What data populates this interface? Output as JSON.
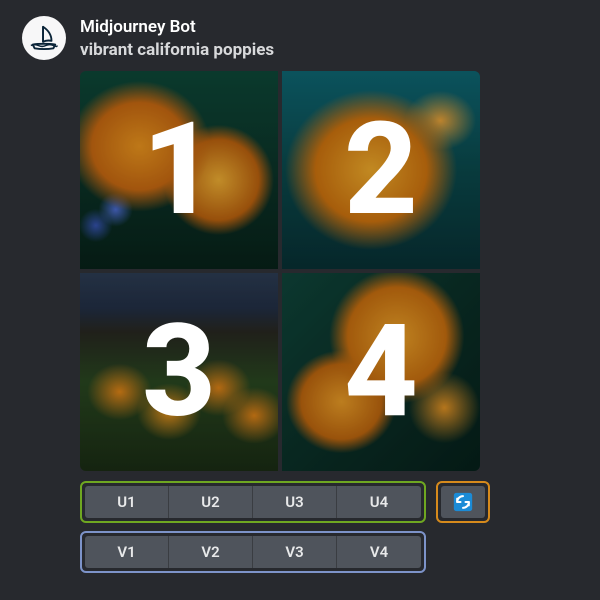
{
  "bot": {
    "name": "Midjourney Bot"
  },
  "prompt": "vibrant california poppies",
  "grid": {
    "cells": [
      {
        "num": "1"
      },
      {
        "num": "2"
      },
      {
        "num": "3"
      },
      {
        "num": "4"
      }
    ]
  },
  "buttons": {
    "upscale": [
      "U1",
      "U2",
      "U3",
      "U4"
    ],
    "variation": [
      "V1",
      "V2",
      "V3",
      "V4"
    ],
    "reroll_icon": "refresh-icon"
  },
  "colors": {
    "upscale_border": "#6fa721",
    "variation_border": "#7d93c9",
    "reroll_border": "#d68a1c",
    "button_bg": "#4f545c"
  }
}
